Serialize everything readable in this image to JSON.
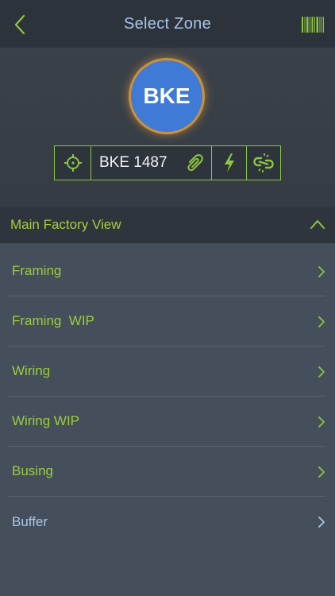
{
  "colors": {
    "accent_green": "#8dc63f",
    "title_blue": "#a9c6ea",
    "avatar_blue": "#3f7bd6",
    "navbar_bg": "#2d333a",
    "list_bg": "#454f5b"
  },
  "navbar": {
    "title": "Select Zone",
    "back_icon": "chevron-left-icon",
    "barcode_icon": "barcode-icon"
  },
  "device": {
    "avatar_text": "BKE",
    "name": "BKE 1487",
    "icons": [
      "crosshair-icon",
      "paperclip-icon",
      "lightning-icon",
      "broken-link-icon"
    ]
  },
  "section": {
    "title": "Main Factory View",
    "expanded": true
  },
  "zones": [
    {
      "label": "Framing",
      "color": "green"
    },
    {
      "label": "Framing  WIP",
      "color": "green"
    },
    {
      "label": "Wiring",
      "color": "green"
    },
    {
      "label": "Wiring WIP",
      "color": "green"
    },
    {
      "label": "Busing",
      "color": "green"
    },
    {
      "label": "Buffer",
      "color": "blue"
    }
  ]
}
